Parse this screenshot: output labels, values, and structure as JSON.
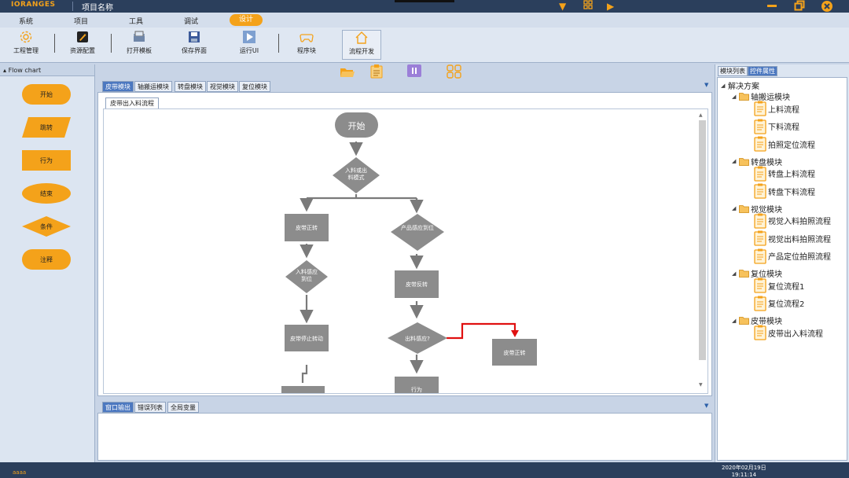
{
  "app": {
    "logo": "IORANGES",
    "project_name": "项目名称"
  },
  "menu": {
    "items": [
      "系统",
      "项目",
      "工具",
      "调试"
    ],
    "active": "设计"
  },
  "toolbar": {
    "items": [
      {
        "label": "工程管理",
        "icon": "gear-icon"
      },
      {
        "label": "资源配置",
        "icon": "pencil-icon"
      },
      {
        "label": "打开模板",
        "icon": "open-template-icon"
      },
      {
        "label": "保存界面",
        "icon": "save-icon"
      },
      {
        "label": "运行UI",
        "icon": "run-icon"
      },
      {
        "label": "程序块",
        "icon": "gamepad-icon"
      },
      {
        "label": "流程开发",
        "icon": "home-icon"
      }
    ]
  },
  "left_panel": {
    "title": "Flow chart",
    "shapes": [
      "开始",
      "跳转",
      "行为",
      "结束",
      "条件",
      "注释"
    ]
  },
  "editor": {
    "tabs": [
      "皮带模块",
      "轴搬运模块",
      "转盘模块",
      "视觉模块",
      "复位模块"
    ],
    "active_subtab": "皮带出入料流程"
  },
  "flowchart": {
    "start": "开始",
    "decision_mode": "入料或出料模式",
    "belt_forward": "皮带正转",
    "product_sensed": "产品感应到位",
    "infeed_sensed": "入料感应到位",
    "belt_reverse": "皮带反转",
    "belt_stop": "皮带停止转动",
    "outfeed_sensed": "出料感应?",
    "belt_forward_2": "皮带正转",
    "action": "行为"
  },
  "output": {
    "tabs": [
      "窗口输出",
      "错误列表",
      "全局变量"
    ]
  },
  "right_panel": {
    "tabs": [
      "模块列表",
      "控件属性"
    ],
    "tree": {
      "root": "解决方案",
      "groups": [
        {
          "name": "轴搬运模块",
          "children": [
            "上料流程",
            "下料流程",
            "拍照定位流程"
          ]
        },
        {
          "name": "转盘模块",
          "children": [
            "转盘上料流程",
            "转盘下料流程"
          ]
        },
        {
          "name": "视觉模块",
          "children": [
            "视觉入料拍照流程",
            "视觉出料拍照流程",
            "产品定位拍照流程"
          ]
        },
        {
          "name": "复位模块",
          "children": [
            "复位流程1",
            "复位流程2"
          ]
        },
        {
          "name": "皮带模块",
          "children": [
            "皮带出入料流程"
          ]
        }
      ]
    }
  },
  "status": {
    "left": "aaaa",
    "date": "2020年02月19日",
    "time": "19:11:14"
  },
  "colors": {
    "accent": "#f4a21a",
    "titlebar": "#2b3f5c",
    "node_gray": "#8c8c8c",
    "highlight_line": "#e01010"
  }
}
